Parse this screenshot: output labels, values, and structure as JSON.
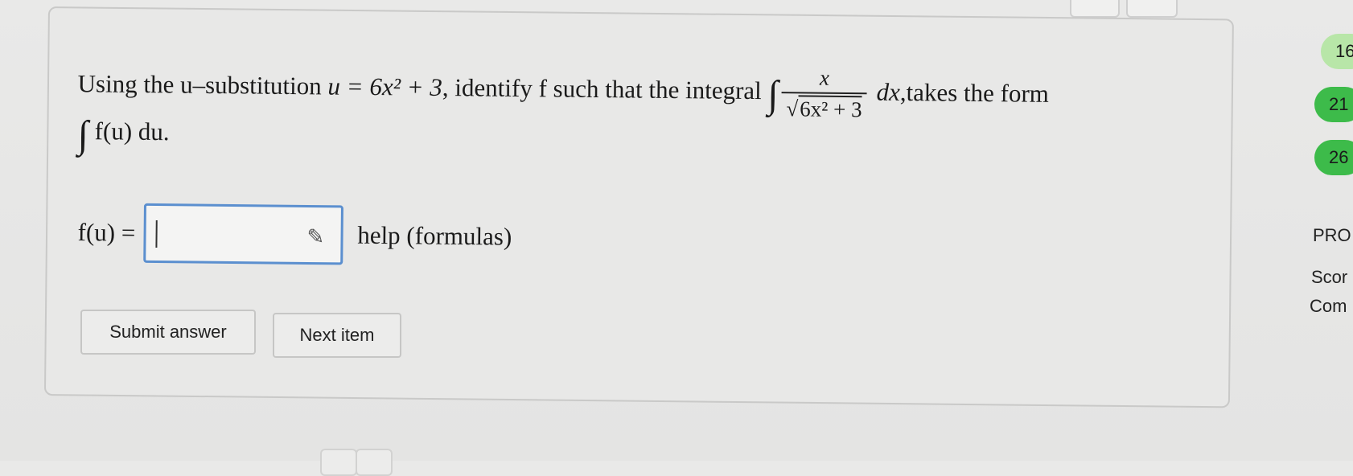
{
  "question": {
    "prefix": "Using the u–substitution ",
    "u_def": "u = 6x² + 3",
    "middle": ", identify f such that the integral ",
    "int_num": "x",
    "int_den": "6x² + 3",
    "dx": "dx",
    "suffix": ",takes the form",
    "form": "f(u) du."
  },
  "answer": {
    "label": "f(u) =",
    "value": "",
    "help": "help (formulas)"
  },
  "buttons": {
    "submit": "Submit answer",
    "next": "Next item"
  },
  "sidebar": {
    "bubble1": "16",
    "bubble2": "21",
    "bubble3": "26",
    "pro": "PRO",
    "score": "Scor",
    "com": "Com"
  },
  "colors": {
    "input_border": "#5b8fcf",
    "bubble_green": "#3dbb4a",
    "bubble_light": "#b8e6a8"
  }
}
